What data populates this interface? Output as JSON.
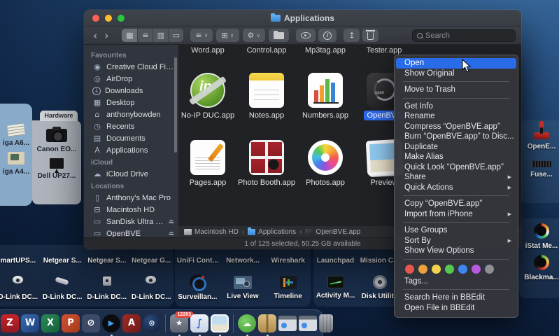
{
  "colors": {
    "accent": "#2c68e8",
    "menu_highlight": "#2a6be8",
    "tag_colors": [
      "#e8574d",
      "#eda03c",
      "#f2d24b",
      "#55c94f",
      "#3f86f2",
      "#b85ae0",
      "#8e8e93"
    ]
  },
  "icons": {
    "back": "‹",
    "forward": "›",
    "icon-view": "▦",
    "list-view": "≡",
    "column-view": "▥",
    "gallery-view": "▭",
    "group": "≡",
    "arrange": "⊞",
    "gear": "⚙",
    "chevron-down": "∨",
    "share": "↥",
    "creative-cloud": "◉",
    "airdrop": "◎",
    "downloads": "↓",
    "desktop": "▦",
    "home": "⌂",
    "recents": "◷",
    "documents": "▤",
    "applications": "A",
    "icloud": "☁",
    "mac-pro": "▯",
    "hdd": "⊟",
    "external-disk": "▭",
    "eject": "⏏"
  },
  "window": {
    "title": "Applications"
  },
  "toolbar": {
    "search_placeholder": "Search"
  },
  "sidebar": {
    "sections": [
      {
        "title": "Favourites",
        "items": [
          {
            "label": "Creative Cloud Files",
            "icon": "creative-cloud"
          },
          {
            "label": "AirDrop",
            "icon": "airdrop"
          },
          {
            "label": "Downloads",
            "icon": "downloads"
          },
          {
            "label": "Desktop",
            "icon": "desktop"
          },
          {
            "label": "anthonybowden",
            "icon": "home"
          },
          {
            "label": "Recents",
            "icon": "recents"
          },
          {
            "label": "Documents",
            "icon": "documents"
          },
          {
            "label": "Applications",
            "icon": "applications"
          }
        ]
      },
      {
        "title": "iCloud",
        "items": [
          {
            "label": "iCloud Drive",
            "icon": "icloud"
          }
        ]
      },
      {
        "title": "Locations",
        "items": [
          {
            "label": "Anthony's Mac Pro",
            "icon": "mac-pro"
          },
          {
            "label": "Macintosh HD",
            "icon": "hdd"
          },
          {
            "label": "SanDisk Ultra II 48...",
            "icon": "external-disk",
            "eject": true
          },
          {
            "label": "OpenBVE",
            "icon": "external-disk",
            "eject": true
          }
        ]
      }
    ]
  },
  "content": {
    "partial_labels": [
      "Word.app",
      "Control.app",
      "Mp3tag.app",
      "Tester.app"
    ],
    "apps": [
      {
        "name": "No-IP DUC.app",
        "kind": "noip"
      },
      {
        "name": "Notes.app",
        "kind": "notes"
      },
      {
        "name": "Numbers.app",
        "kind": "numbers"
      },
      {
        "name": "OpenBVE",
        "kind": "openbve",
        "selected": true
      },
      {
        "name": "Pages.app",
        "kind": "pages"
      },
      {
        "name": "Photo Booth.app",
        "kind": "pbooth"
      },
      {
        "name": "Photos.app",
        "kind": "photos"
      },
      {
        "name": "Preview",
        "kind": "preview"
      }
    ]
  },
  "path_bar": {
    "items": [
      {
        "label": "Macintosh HD",
        "icon": "disk"
      },
      {
        "label": "Applications",
        "icon": "folder"
      },
      {
        "label": "OpenBVE.app",
        "icon": "app"
      }
    ]
  },
  "status_bar": {
    "text": "1 of 125 selected, 50.25 GB available"
  },
  "context_menu": {
    "items": [
      {
        "type": "item",
        "label": "Open",
        "highlighted": true
      },
      {
        "type": "item",
        "label": "Show Original"
      },
      {
        "type": "separator"
      },
      {
        "type": "item",
        "label": "Move to Trash"
      },
      {
        "type": "separator"
      },
      {
        "type": "item",
        "label": "Get Info"
      },
      {
        "type": "item",
        "label": "Rename"
      },
      {
        "type": "item",
        "label": "Compress “OpenBVE.app”"
      },
      {
        "type": "item",
        "label": "Burn “OpenBVE.app” to Disc..."
      },
      {
        "type": "item",
        "label": "Duplicate"
      },
      {
        "type": "item",
        "label": "Make Alias"
      },
      {
        "type": "item",
        "label": "Quick Look “OpenBVE.app”"
      },
      {
        "type": "item",
        "label": "Share",
        "submenu": true
      },
      {
        "type": "item",
        "label": "Quick Actions",
        "submenu": true
      },
      {
        "type": "separator"
      },
      {
        "type": "item",
        "label": "Copy “OpenBVE.app”"
      },
      {
        "type": "item",
        "label": "Import from iPhone",
        "submenu": true
      },
      {
        "type": "separator"
      },
      {
        "type": "item",
        "label": "Use Groups"
      },
      {
        "type": "item",
        "label": "Sort By",
        "submenu": true
      },
      {
        "type": "item",
        "label": "Show View Options"
      },
      {
        "type": "separator"
      },
      {
        "type": "tags"
      },
      {
        "type": "item",
        "label": "Tags..."
      },
      {
        "type": "separator"
      },
      {
        "type": "item",
        "label": "Search Here in BBEdit"
      },
      {
        "type": "item",
        "label": "Open File in BBEdit"
      }
    ]
  },
  "desktop": {
    "hardware_tab": "Hardware",
    "panels": [
      {
        "id": "left-group",
        "layout": "vstack",
        "style": "light",
        "items": [
          {
            "label": "iga A6...",
            "kind": "newspaper"
          },
          {
            "label": "iga A4...",
            "kind": "oldcomputer"
          }
        ]
      },
      {
        "id": "hardware",
        "layout": "vstack",
        "style": "light",
        "items": [
          {
            "label": "Canon EO...",
            "kind": "dslr"
          },
          {
            "label": "Dell UP27...",
            "kind": "monitor"
          }
        ]
      },
      {
        "id": "right-games",
        "layout": "vstack",
        "style": "dark",
        "items": [
          {
            "label": "OpenE...",
            "kind": "joystick"
          },
          {
            "label": "Fuse...",
            "kind": "keyboard"
          }
        ]
      },
      {
        "id": "right-gauges",
        "layout": "vstack",
        "style": "dark",
        "items": [
          {
            "label": "iStat Me...",
            "kind": "gauge"
          },
          {
            "label": "Blackma...",
            "kind": "gauge2"
          }
        ]
      },
      {
        "id": "bottom-a",
        "layout": "rows",
        "style": "dark",
        "label_row": [
          "martUPS...",
          "Netgear S...",
          "Netgear S...",
          "Netgear G..."
        ],
        "icon_row": [
          {
            "label": "D-Link DC...",
            "kind": "cam-dome"
          },
          {
            "label": "D-Link DC...",
            "kind": "cam-bullet"
          },
          {
            "label": "D-Link DC...",
            "kind": "cam-cube"
          },
          {
            "label": "D-Link DC...",
            "kind": "cam-dome"
          }
        ]
      },
      {
        "id": "bottom-b",
        "layout": "rows",
        "style": "dark",
        "label_row": [
          "UniFi Cont...",
          "Network...",
          "Wireshark"
        ],
        "icon_row": [
          {
            "label": "Surveillan...",
            "kind": "surveillance"
          },
          {
            "label": "Live View",
            "kind": "liveview"
          },
          {
            "label": "Timeline",
            "kind": "timeline"
          }
        ]
      },
      {
        "id": "bottom-c",
        "layout": "rows",
        "style": "dark",
        "label_row": [
          "Launchpad",
          "Mission C..."
        ],
        "icon_row": [
          {
            "label": "Activity M...",
            "kind": "activity"
          },
          {
            "label": "Disk Utility",
            "kind": "diskutil"
          }
        ]
      }
    ]
  },
  "dock": {
    "items": [
      {
        "kind": "filezilla",
        "name": "filezilla",
        "letter": "Z"
      },
      {
        "kind": "word",
        "name": "microsoft-word",
        "letter": "W"
      },
      {
        "kind": "excel",
        "name": "microsoft-excel",
        "letter": "X"
      },
      {
        "kind": "powerpoint",
        "name": "microsoft-powerpoint",
        "letter": "P"
      },
      {
        "kind": "noip",
        "name": "no-ip-duc",
        "letter": "⊘"
      },
      {
        "kind": "player",
        "name": "media-player",
        "letter": "▶",
        "running": true
      },
      {
        "kind": "reda",
        "name": "red-a-app",
        "letter": "A"
      },
      {
        "kind": "steam",
        "name": "steam",
        "letter": "⊙"
      },
      {
        "kind": "sep"
      },
      {
        "kind": "badged",
        "name": "notification-app",
        "letter": "★",
        "badge": "12203",
        "running": true
      },
      {
        "kind": "scroll",
        "name": "script-editor",
        "letter": "∫",
        "running": true
      },
      {
        "kind": "imageviewer",
        "name": "image-viewer",
        "letter": "",
        "running": true
      },
      {
        "kind": "sep"
      },
      {
        "kind": "cloud",
        "name": "cloud-app",
        "letter": "☁",
        "running": true
      },
      {
        "kind": "package",
        "name": "package-app",
        "letter": "",
        "running": true
      },
      {
        "kind": "window",
        "name": "minimized-window",
        "letter": ""
      },
      {
        "kind": "window",
        "name": "minimized-window",
        "letter": ""
      },
      {
        "kind": "trash",
        "name": "trash",
        "letter": ""
      }
    ]
  }
}
